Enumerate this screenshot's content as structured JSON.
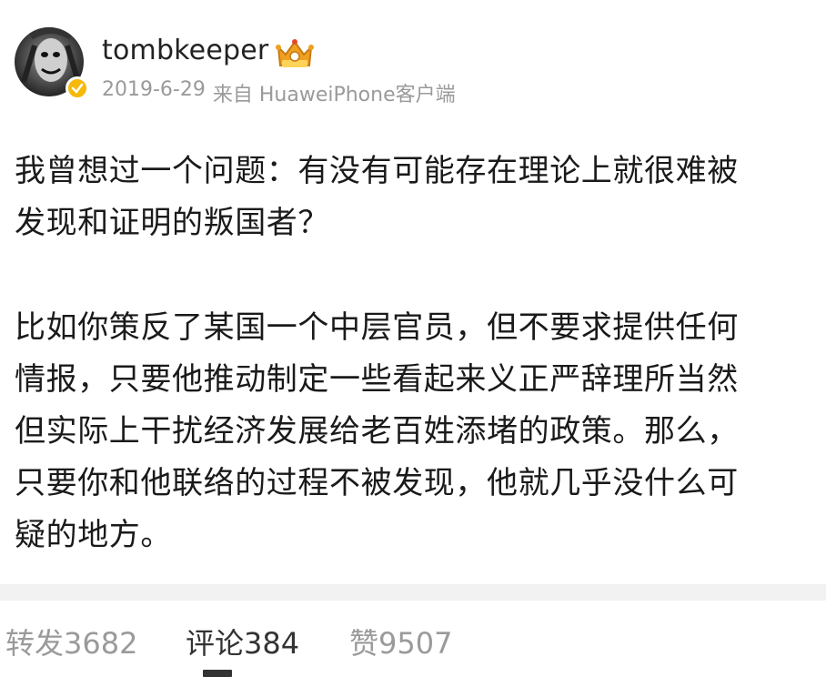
{
  "post": {
    "author": {
      "username": "tombkeeper",
      "avatar_icon": "user-avatar",
      "verified_icon": "verified-badge-icon",
      "member_icon": "crown-badge-icon",
      "verified_color": "#f5b90a"
    },
    "meta": {
      "date": "2019-6-29",
      "source": "来自 HuaweiPhone客户端"
    },
    "content": {
      "paragraphs": [
        "我曾想过一个问题：有没有可能存在理论上就很难被\n发现和证明的叛国者？",
        "比如你策反了某国一个中层官员，但不要求提供任何\n情报，只要他推动制定一些看起来义正严辞理所当然\n但实际上干扰经济发展给老百姓添堵的政策。那么，\n只要你和他联络的过程不被发现，他就几乎没什么可\n疑的地方。"
      ]
    },
    "actions": {
      "repost": "转发3682",
      "comment": "评论384",
      "like": "赞9507",
      "active_tab": "comment"
    }
  }
}
